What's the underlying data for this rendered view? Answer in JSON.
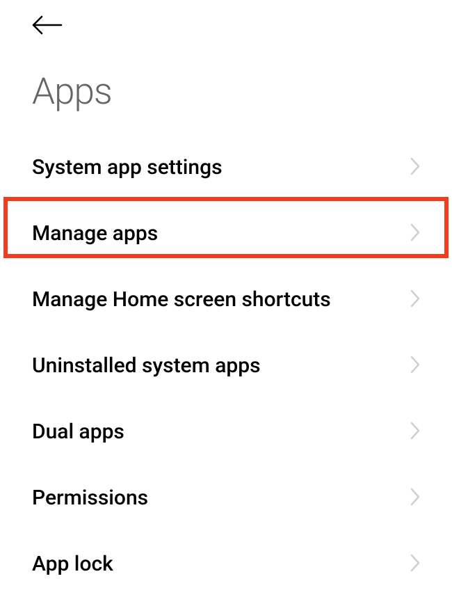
{
  "header": {
    "title": "Apps"
  },
  "list": {
    "items": [
      {
        "label": "System app settings"
      },
      {
        "label": "Manage apps"
      },
      {
        "label": "Manage Home screen shortcuts"
      },
      {
        "label": "Uninstalled system apps"
      },
      {
        "label": "Dual apps"
      },
      {
        "label": "Permissions"
      },
      {
        "label": "App lock"
      }
    ]
  },
  "colors": {
    "highlight": "#f13c1f",
    "chevron": "#cfcfcf",
    "title": "#666",
    "text": "#000"
  }
}
